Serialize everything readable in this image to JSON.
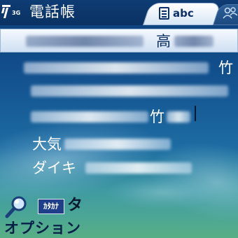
{
  "status": {
    "network": "3G"
  },
  "header": {
    "title": "電話帳",
    "tabs": [
      {
        "label": "abc",
        "active": true,
        "icon": "phonebook-icon"
      },
      {
        "label": "",
        "active": false,
        "icon": "group-icon"
      }
    ]
  },
  "contacts": [
    {
      "visible_text": "高",
      "selected": true
    },
    {
      "visible_text": "竹",
      "selected": false
    },
    {
      "visible_text": "",
      "selected": false
    },
    {
      "visible_text": "竹",
      "selected": false
    },
    {
      "visible_text": "大気",
      "selected": false
    },
    {
      "visible_text": "ダイキ",
      "selected": false
    }
  ],
  "search": {
    "mode_label": "ｶﾀｶﾅ",
    "query": "タ"
  },
  "softkeys": {
    "left": "オプション"
  },
  "colors": {
    "background": "#114a83",
    "title_bar": "#0a3263",
    "selection": "#e3edf9",
    "kana_badge": "#1f3f8a"
  }
}
